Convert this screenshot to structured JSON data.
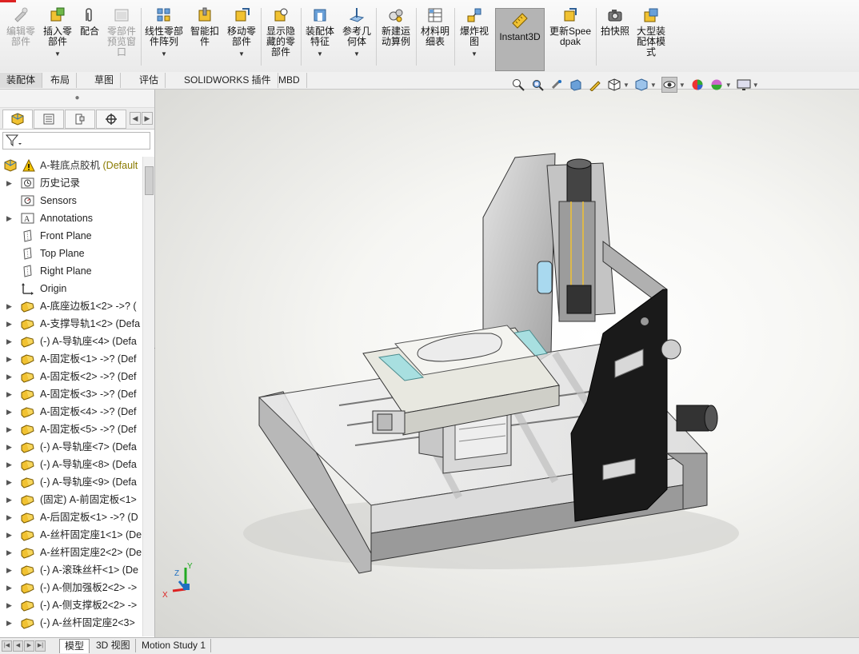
{
  "ribbon": {
    "buttons": [
      {
        "label": "编辑零部件"
      },
      {
        "label": "插入零部件"
      },
      {
        "label": "配合"
      },
      {
        "label": "零部件预览窗口"
      },
      {
        "label": "线性零部件阵列"
      },
      {
        "label": "智能扣件"
      },
      {
        "label": "移动零部件"
      },
      {
        "label": "显示隐藏的零部件"
      },
      {
        "label": "装配体特征"
      },
      {
        "label": "参考几何体"
      },
      {
        "label": "新建运动算例"
      },
      {
        "label": "材料明细表"
      },
      {
        "label": "爆炸视图"
      },
      {
        "label": "Instant3D"
      },
      {
        "label": "更新Speedpak"
      },
      {
        "label": "拍快照"
      },
      {
        "label": "大型装配体模式"
      }
    ]
  },
  "tabs": [
    "装配体",
    "布局",
    "草图",
    "评估",
    "SOLIDWORKS 插件",
    "MBD"
  ],
  "tree": {
    "root": {
      "label": "A-鞋底点胶机",
      "config": "(Default"
    },
    "items": [
      {
        "label": "历史记录",
        "icon": "history-icon",
        "exp": true
      },
      {
        "label": "Sensors",
        "icon": "sensors-icon",
        "exp": false
      },
      {
        "label": "Annotations",
        "icon": "annotations-icon",
        "exp": true
      },
      {
        "label": "Front Plane",
        "icon": "plane-icon",
        "exp": false
      },
      {
        "label": "Top Plane",
        "icon": "plane-icon",
        "exp": false
      },
      {
        "label": "Right Plane",
        "icon": "plane-icon",
        "exp": false
      },
      {
        "label": "Origin",
        "icon": "origin-icon",
        "exp": false
      },
      {
        "label": "A-底座边板1<2> ->? (",
        "icon": "part-icon",
        "exp": true
      },
      {
        "label": "A-支撑导轨1<2> (Defa",
        "icon": "part-icon",
        "exp": true
      },
      {
        "label": "(-) A-导轨座<4> (Defa",
        "icon": "part-icon",
        "exp": true
      },
      {
        "label": "A-固定板<1> ->? (Def",
        "icon": "part-icon",
        "exp": true
      },
      {
        "label": "A-固定板<2> ->? (Def",
        "icon": "part-icon",
        "exp": true
      },
      {
        "label": "A-固定板<3> ->? (Def",
        "icon": "part-icon",
        "exp": true
      },
      {
        "label": "A-固定板<4> ->? (Def",
        "icon": "part-icon",
        "exp": true
      },
      {
        "label": "A-固定板<5> ->? (Def",
        "icon": "part-icon",
        "exp": true
      },
      {
        "label": "(-) A-导轨座<7> (Defa",
        "icon": "part-icon",
        "exp": true
      },
      {
        "label": "(-) A-导轨座<8> (Defa",
        "icon": "part-icon",
        "exp": true
      },
      {
        "label": "(-) A-导轨座<9> (Defa",
        "icon": "part-icon",
        "exp": true
      },
      {
        "label": "(固定) A-前固定板<1>",
        "icon": "part-icon",
        "exp": true
      },
      {
        "label": "A-后固定板<1> ->? (D",
        "icon": "part-icon",
        "exp": true
      },
      {
        "label": "A-丝杆固定座1<1> (De",
        "icon": "part-icon",
        "exp": true
      },
      {
        "label": "A-丝杆固定座2<2> (De",
        "icon": "part-icon",
        "exp": true
      },
      {
        "label": "(-) A-滚珠丝杆<1> (De",
        "icon": "part-icon",
        "exp": true
      },
      {
        "label": "(-) A-侧加强板2<2> ->",
        "icon": "part-icon",
        "exp": true
      },
      {
        "label": "(-) A-侧支撑板2<2> ->",
        "icon": "part-icon",
        "exp": true
      },
      {
        "label": "(-) A-丝杆固定座2<3>",
        "icon": "part-icon",
        "exp": true
      }
    ]
  },
  "bottom_tabs": [
    "模型",
    "3D 视图",
    "Motion Study 1"
  ],
  "triad": {
    "x": "X",
    "y": "Y",
    "z": "Z"
  },
  "colors": {
    "accent_blue": "#1f6fc1",
    "part_yellow": "#f1c232",
    "instant3d_bg": "#b4b4b4"
  }
}
